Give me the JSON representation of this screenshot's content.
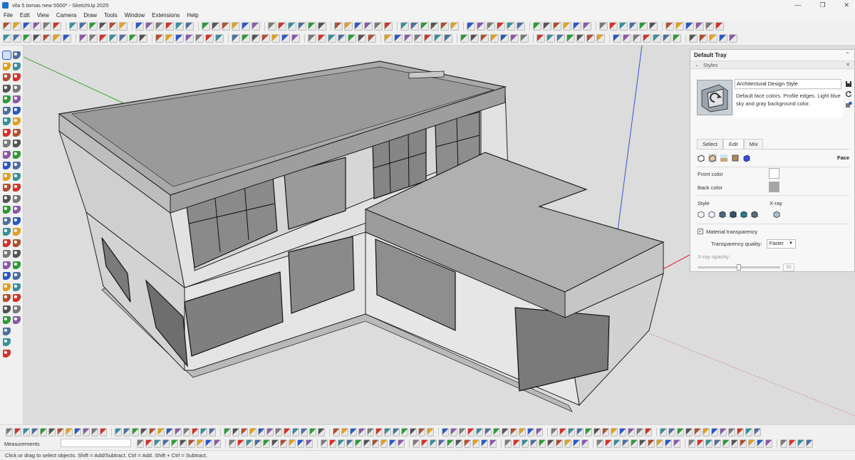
{
  "window": {
    "title": "vila 5 tomas new 5500* - SketchUp 2025",
    "controls": [
      "—",
      "❐",
      "✕"
    ]
  },
  "menu": [
    "File",
    "Edit",
    "View",
    "Camera",
    "Draw",
    "Tools",
    "Window",
    "Extensions",
    "Help"
  ],
  "colors": {
    "viewport_bg": "#dcdcdc",
    "tray_bg": "#f7f7f7",
    "accent_red": "#d2332b",
    "accent_blue": "#2b58c7",
    "accent_green": "#2f9a37"
  },
  "tray": {
    "title": "Default Tray",
    "panel_title": "Styles",
    "style_name": "Architectural Design Style",
    "style_description": "Default face colors. Profile edges. Light blue sky and gray background color.",
    "tabs": [
      "Select",
      "Edit",
      "Mix"
    ],
    "active_tab": "Edit",
    "section": "Face",
    "front_color_label": "Front color",
    "back_color_label": "Back color",
    "front_color": "#ffffff",
    "back_color": "#a6a6a6",
    "style_label": "Style",
    "xray_label": "X-ray",
    "material_transparency_label": "Material transparency",
    "material_transparency_checked": "✓",
    "transparency_quality_label": "Transparency quality:",
    "transparency_quality_value": "Faster",
    "xray_opacity_label": "X-ray opacity:",
    "xray_opacity_value": "50"
  },
  "bottom": {
    "measurements_label": "Measurements"
  },
  "status": {
    "hint": "Click or drag to select objects. Shift = Add/Subtract. Ctrl = Add. Shift + Ctrl = Subtract."
  }
}
